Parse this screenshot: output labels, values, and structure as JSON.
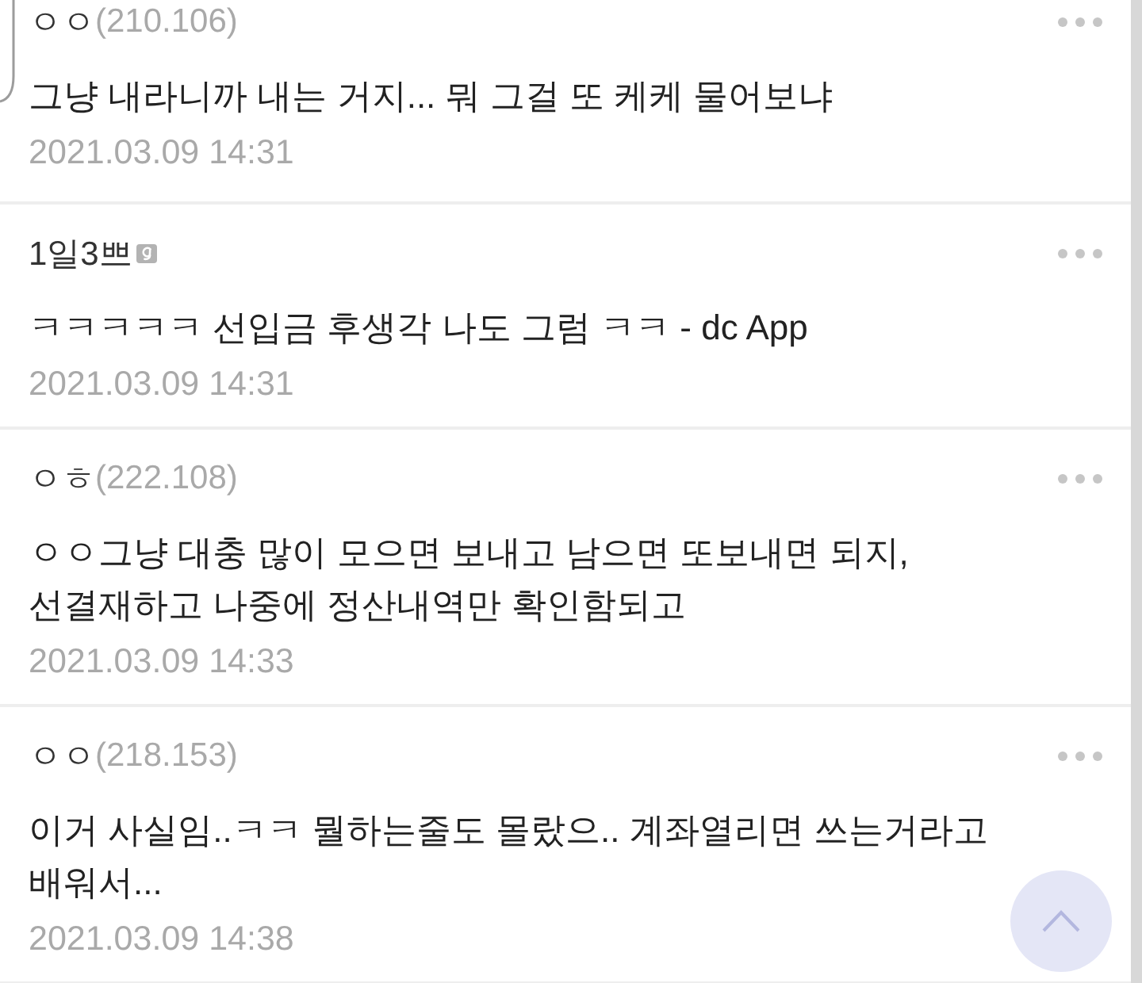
{
  "comments": [
    {
      "author": "ㅇㅇ",
      "ip": "(210.106)",
      "badge": false,
      "body": "그냥 내라니까 내는 거지... 뭐 그걸 또 케케 물어보냐",
      "time": "2021.03.09 14:31"
    },
    {
      "author": "1일3쁘",
      "badge": true,
      "body": "ㅋㅋㅋㅋㅋ 선입금 후생각 나도 그럼 ㅋㅋ - dc App",
      "time": "2021.03.09 14:31"
    },
    {
      "author": "ㅇㅎ",
      "ip": "(222.108)",
      "badge": false,
      "body": "ㅇㅇ그냥 대충 많이 모으면 보내고 남으면 또보내면 되지,\n선결재하고 나중에 정산내역만 확인함되고",
      "time": "2021.03.09 14:33"
    },
    {
      "author": "ㅇㅇ",
      "ip": "(218.153)",
      "badge": false,
      "body": "이거 사실임..ㅋㅋ 뭘하는줄도 몰랐으.. 계좌열리면 쓰는거라고\n배워서...",
      "time": "2021.03.09 14:38"
    }
  ]
}
